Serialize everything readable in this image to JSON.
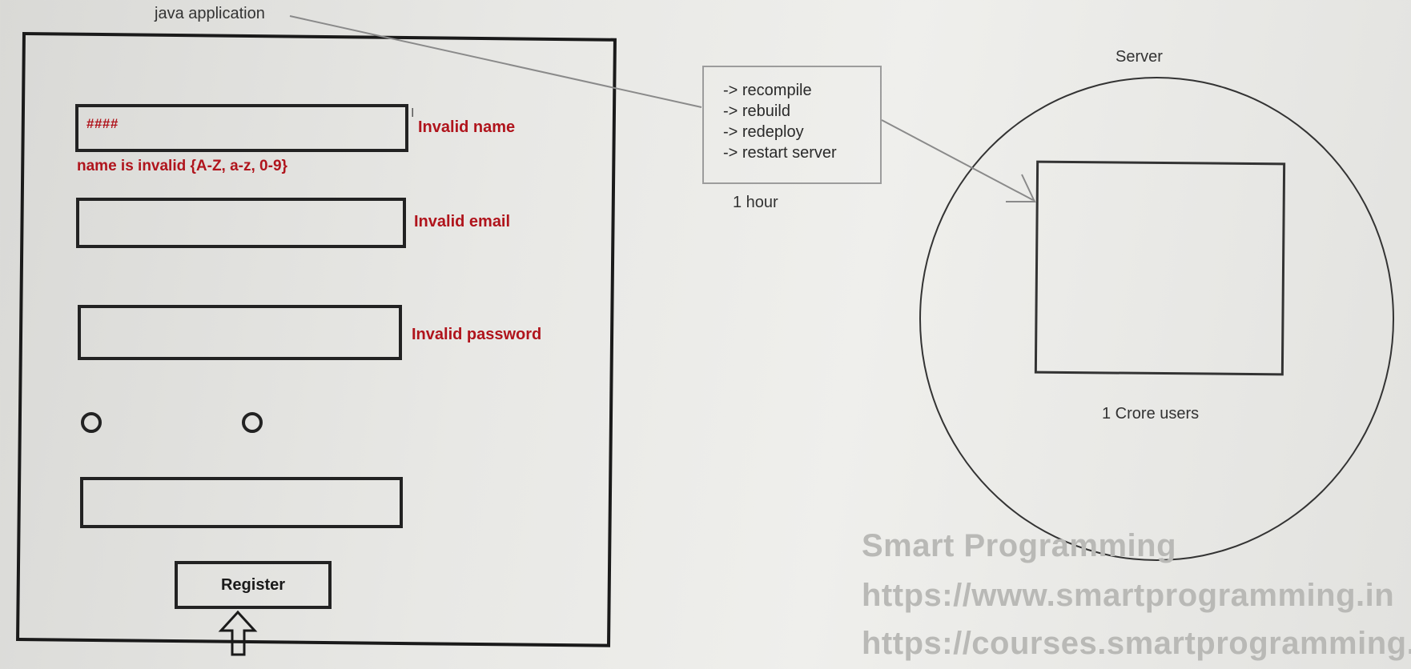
{
  "app": {
    "title": "java application",
    "name_input_value": "####",
    "name_error": "Invalid name",
    "name_hint": "name is invalid {A-Z, a-z, 0-9}",
    "email_error": "Invalid email",
    "password_error": "Invalid password",
    "register_label": "Register"
  },
  "process": {
    "steps": [
      "-> recompile",
      "-> rebuild",
      "-> redeploy",
      "-> restart server"
    ],
    "duration": "1 hour"
  },
  "server": {
    "title": "Server",
    "users": "1 Crore users"
  },
  "watermark": {
    "name": "Smart Programming",
    "url1": "https://www.smartprogramming.in",
    "url2": "https://courses.smartprogramming."
  },
  "colors": {
    "error": "#b0141c",
    "stroke": "#222222"
  }
}
